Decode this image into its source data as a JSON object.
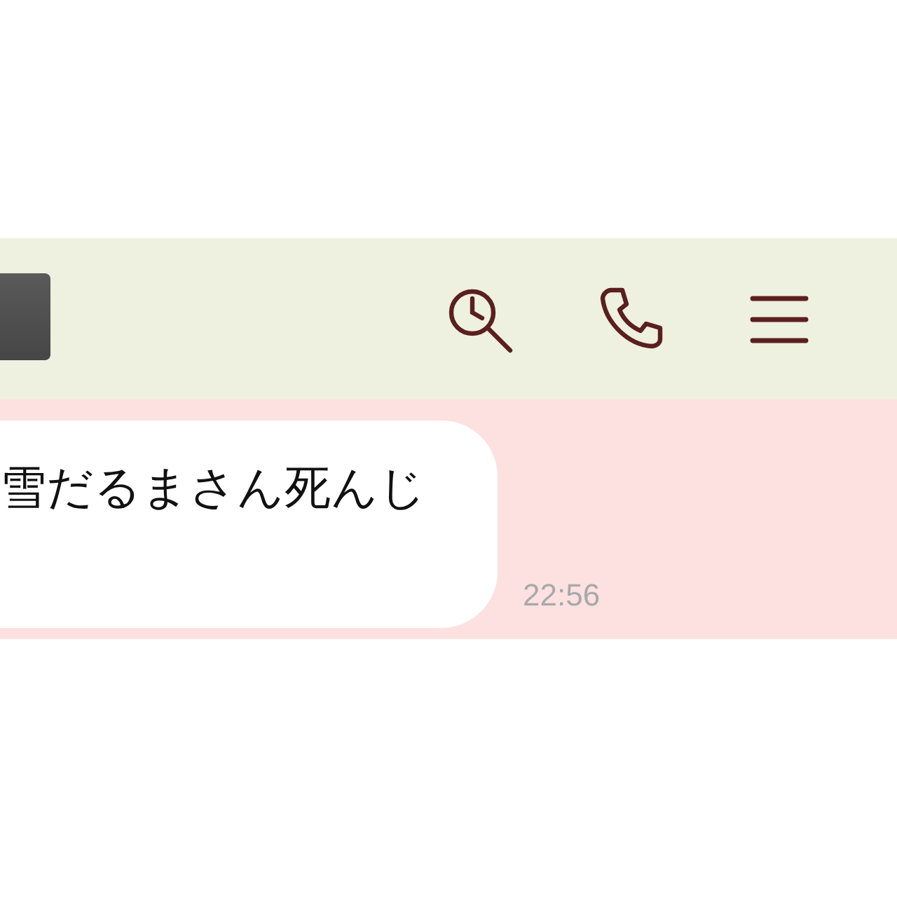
{
  "header": {
    "actions": [
      {
        "kind": "search"
      },
      {
        "kind": "call"
      },
      {
        "kind": "menu"
      }
    ]
  },
  "messages": [
    {
      "text": "雪だるまさん死んじ",
      "time": "22:56"
    }
  ]
}
